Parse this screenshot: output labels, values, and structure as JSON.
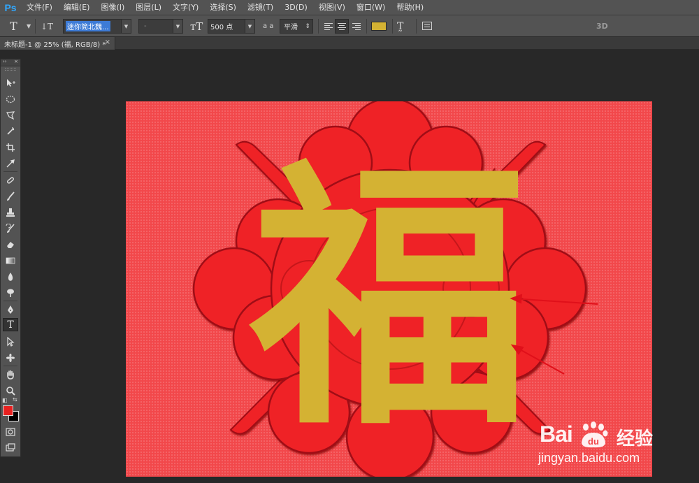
{
  "app": {
    "logo": "Ps"
  },
  "menu": [
    "文件(F)",
    "编辑(E)",
    "图像(I)",
    "图层(L)",
    "文字(Y)",
    "选择(S)",
    "滤镜(T)",
    "3D(D)",
    "视图(V)",
    "窗口(W)",
    "帮助(H)"
  ],
  "options": {
    "font_family": "迷你简北魏...",
    "font_style": "-",
    "font_size": "500 点",
    "aa_label": "a a",
    "anti_alias": "平滑",
    "text_color": "#d4b233",
    "label_3d": "3D"
  },
  "document_tab": {
    "title": "未标题-1 @ 25% (福, RGB/8) *",
    "close": "×"
  },
  "toolbox": {
    "header_left": "››",
    "header_right": "×",
    "tools": [
      "move-tool",
      "marquee-tool",
      "lasso-tool",
      "magic-wand-tool",
      "crop-tool",
      "eyedropper-tool",
      "healing-brush-tool",
      "brush-tool",
      "clone-stamp-tool",
      "history-brush-tool",
      "eraser-tool",
      "gradient-tool",
      "blur-tool",
      "dodge-tool",
      "pen-tool",
      "type-tool",
      "path-selection-tool",
      "shape-tool",
      "hand-tool",
      "zoom-tool"
    ],
    "active_tool": "type-tool",
    "foreground_color": "#e8201f",
    "background_color": "#000000"
  },
  "canvas": {
    "character": "福",
    "background_color": "#f2484b",
    "flower_color": "#ef2027",
    "text_color": "#d4b233",
    "arrow_color": "#e0101a"
  },
  "watermark": {
    "brand": "Bai",
    "brand_du": "du",
    "brand_cn": "经验",
    "url": "jingyan.baidu.com"
  }
}
